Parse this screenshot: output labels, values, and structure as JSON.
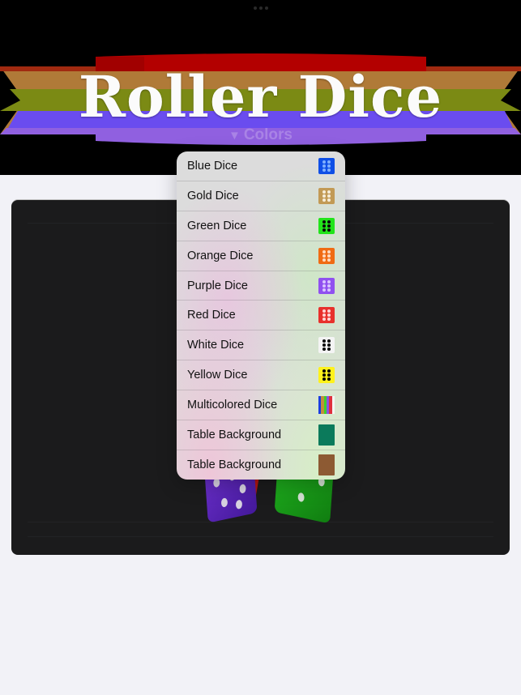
{
  "app": {
    "title": "Roller Dice",
    "colors_button": {
      "icon": "triangle-down-icon",
      "glyph": "▼",
      "label": "Colors"
    }
  },
  "banner": {
    "stripes": [
      "#b30000",
      "#b07a38",
      "#7b8a14",
      "#6a4cef",
      "#9060e0"
    ]
  },
  "menu": {
    "items": [
      {
        "label": "Blue Dice",
        "kind": "die",
        "icon": "blue-die-icon",
        "face": "#0f4fe6",
        "pip": "#7fb0ff"
      },
      {
        "label": "Gold Dice",
        "kind": "die",
        "icon": "gold-die-icon",
        "face": "#c29a55",
        "pip": "#f5ecd8"
      },
      {
        "label": "Green Dice",
        "kind": "die",
        "icon": "green-die-icon",
        "face": "#22e41b",
        "pip": "#0a0a0a"
      },
      {
        "label": "Orange Dice",
        "kind": "die",
        "icon": "orange-die-icon",
        "face": "#f06b13",
        "pip": "#ffd9bd"
      },
      {
        "label": "Purple Dice",
        "kind": "die",
        "icon": "purple-die-icon",
        "face": "#9050f0",
        "pip": "#d9c5ff"
      },
      {
        "label": "Red Dice",
        "kind": "die",
        "icon": "red-die-icon",
        "face": "#e8302c",
        "pip": "#ffd5d5"
      },
      {
        "label": "White Dice",
        "kind": "die",
        "icon": "white-die-icon",
        "face": "#f4f4f4",
        "pip": "#000000"
      },
      {
        "label": "Yellow Dice",
        "kind": "die",
        "icon": "yellow-die-icon",
        "face": "#fff21c",
        "pip": "#000000"
      },
      {
        "label": "Multicolored Dice",
        "kind": "stripes",
        "icon": "multicolor-die-icon",
        "stripes": [
          "#1b3de0",
          "#c28e3a",
          "#3ad12e",
          "#8a52e0",
          "#e02f3c",
          "#f4f4f4"
        ]
      },
      {
        "label": "Table Background",
        "kind": "plain",
        "icon": "green-felt-swatch-icon",
        "face": "#0b7a5b"
      },
      {
        "label": "Table Background",
        "kind": "plain",
        "icon": "brown-wood-swatch-icon",
        "face": "#8d5a33"
      }
    ]
  },
  "table": {
    "dice": [
      {
        "name": "red-die",
        "color": "#b11512"
      },
      {
        "name": "purple-die",
        "color": "#5a24b8"
      },
      {
        "name": "green-die",
        "color": "#17a016"
      }
    ]
  }
}
